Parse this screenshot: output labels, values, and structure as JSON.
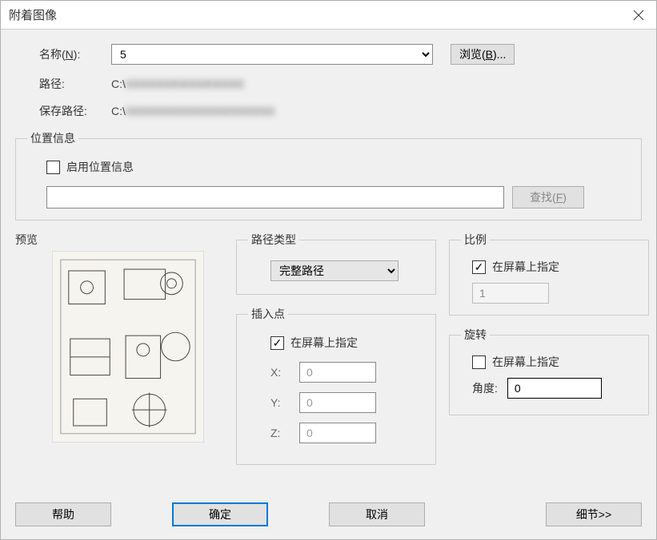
{
  "titlebar": {
    "title": "附着图像"
  },
  "form": {
    "name_label_pre": "名称(",
    "name_label_u": "N",
    "name_label_post": "):",
    "name_value": "5",
    "browse_pre": "浏览(",
    "browse_u": "B",
    "browse_post": ")...",
    "path_label": "路径:",
    "path_value_prefix": "C:\\",
    "path_value_blur": "XXXXXXX\\XXXX\\XXXX",
    "save_path_label": "保存路径:",
    "save_path_value_prefix": "C:\\",
    "save_path_value_blur": "XXXXXXXXXXXXXXXXXXXX"
  },
  "location": {
    "legend": "位置信息",
    "enable_label": "启用位置信息",
    "enable_checked": false,
    "path_value": "",
    "find_pre": "查找(",
    "find_u": "F",
    "find_post": ")"
  },
  "preview": {
    "label": "预览"
  },
  "pathtype": {
    "legend": "路径类型",
    "selected": "完整路径"
  },
  "insert": {
    "legend": "插入点",
    "onscreen_label": "在屏幕上指定",
    "onscreen_checked": true,
    "x_label": "X:",
    "x_value": "0",
    "y_label": "Y:",
    "y_value": "0",
    "z_label": "Z:",
    "z_value": "0"
  },
  "scale": {
    "legend": "比例",
    "onscreen_label": "在屏幕上指定",
    "onscreen_checked": true,
    "value": "1"
  },
  "rotate": {
    "legend": "旋转",
    "onscreen_label": "在屏幕上指定",
    "onscreen_checked": false,
    "angle_label": "角度:",
    "angle_value": "0"
  },
  "buttons": {
    "help": "帮助",
    "ok": "确定",
    "cancel": "取消",
    "details": "细节>>"
  }
}
